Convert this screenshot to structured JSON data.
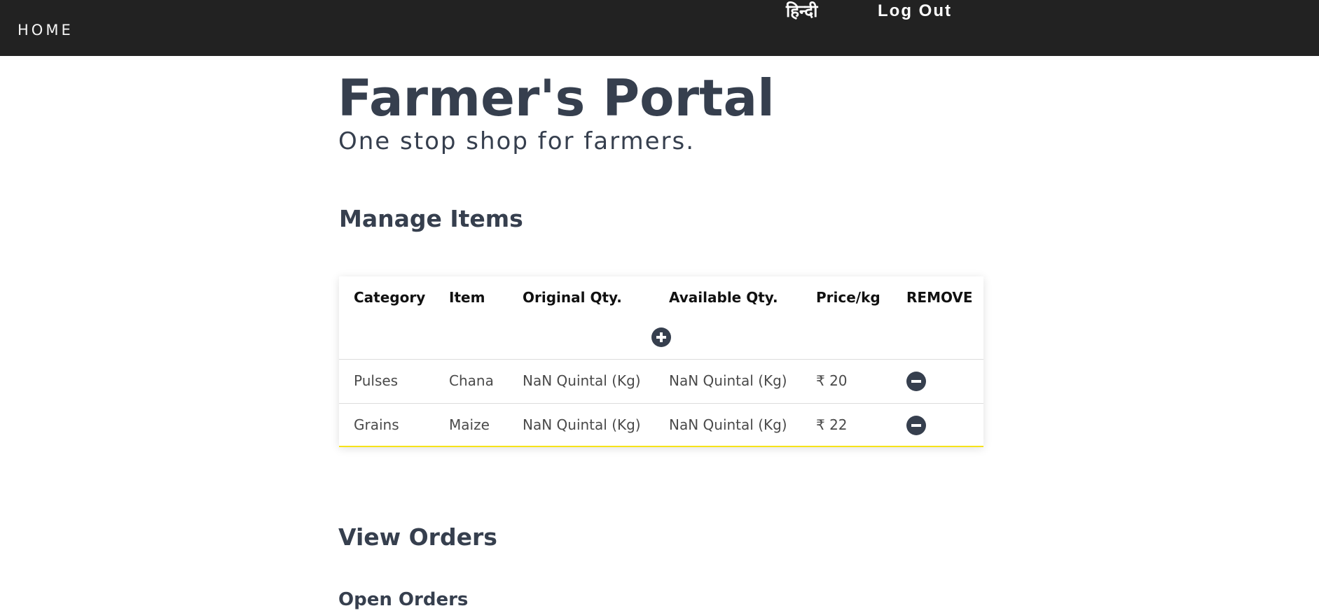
{
  "nav": {
    "home": "HOME",
    "language": "हिन्दी",
    "logout": "Log Out"
  },
  "header": {
    "title": "Farmer's Portal",
    "subtitle": "One stop shop for farmers."
  },
  "manage_items": {
    "heading": "Manage Items",
    "columns": [
      "Category",
      "Item",
      "Original Qty.",
      "Available Qty.",
      "Price/kg",
      "REMOVE"
    ],
    "add_icon": "plus-circle-icon",
    "remove_icon": "minus-circle-icon",
    "rows": [
      {
        "category": "Pulses",
        "item": "Chana",
        "original_qty": "NaN Quintal (Kg)",
        "available_qty": "NaN Quintal (Kg)",
        "price": "₹ 20"
      },
      {
        "category": "Grains",
        "item": "Maize",
        "original_qty": "NaN Quintal (Kg)",
        "available_qty": "NaN Quintal (Kg)",
        "price": "₹ 22"
      }
    ],
    "accent_color": "#f6e21a"
  },
  "view_orders": {
    "heading": "View Orders",
    "open_orders": "Open Orders"
  },
  "colors": {
    "navbar": "#222222",
    "heading_text": "#363f4e"
  }
}
